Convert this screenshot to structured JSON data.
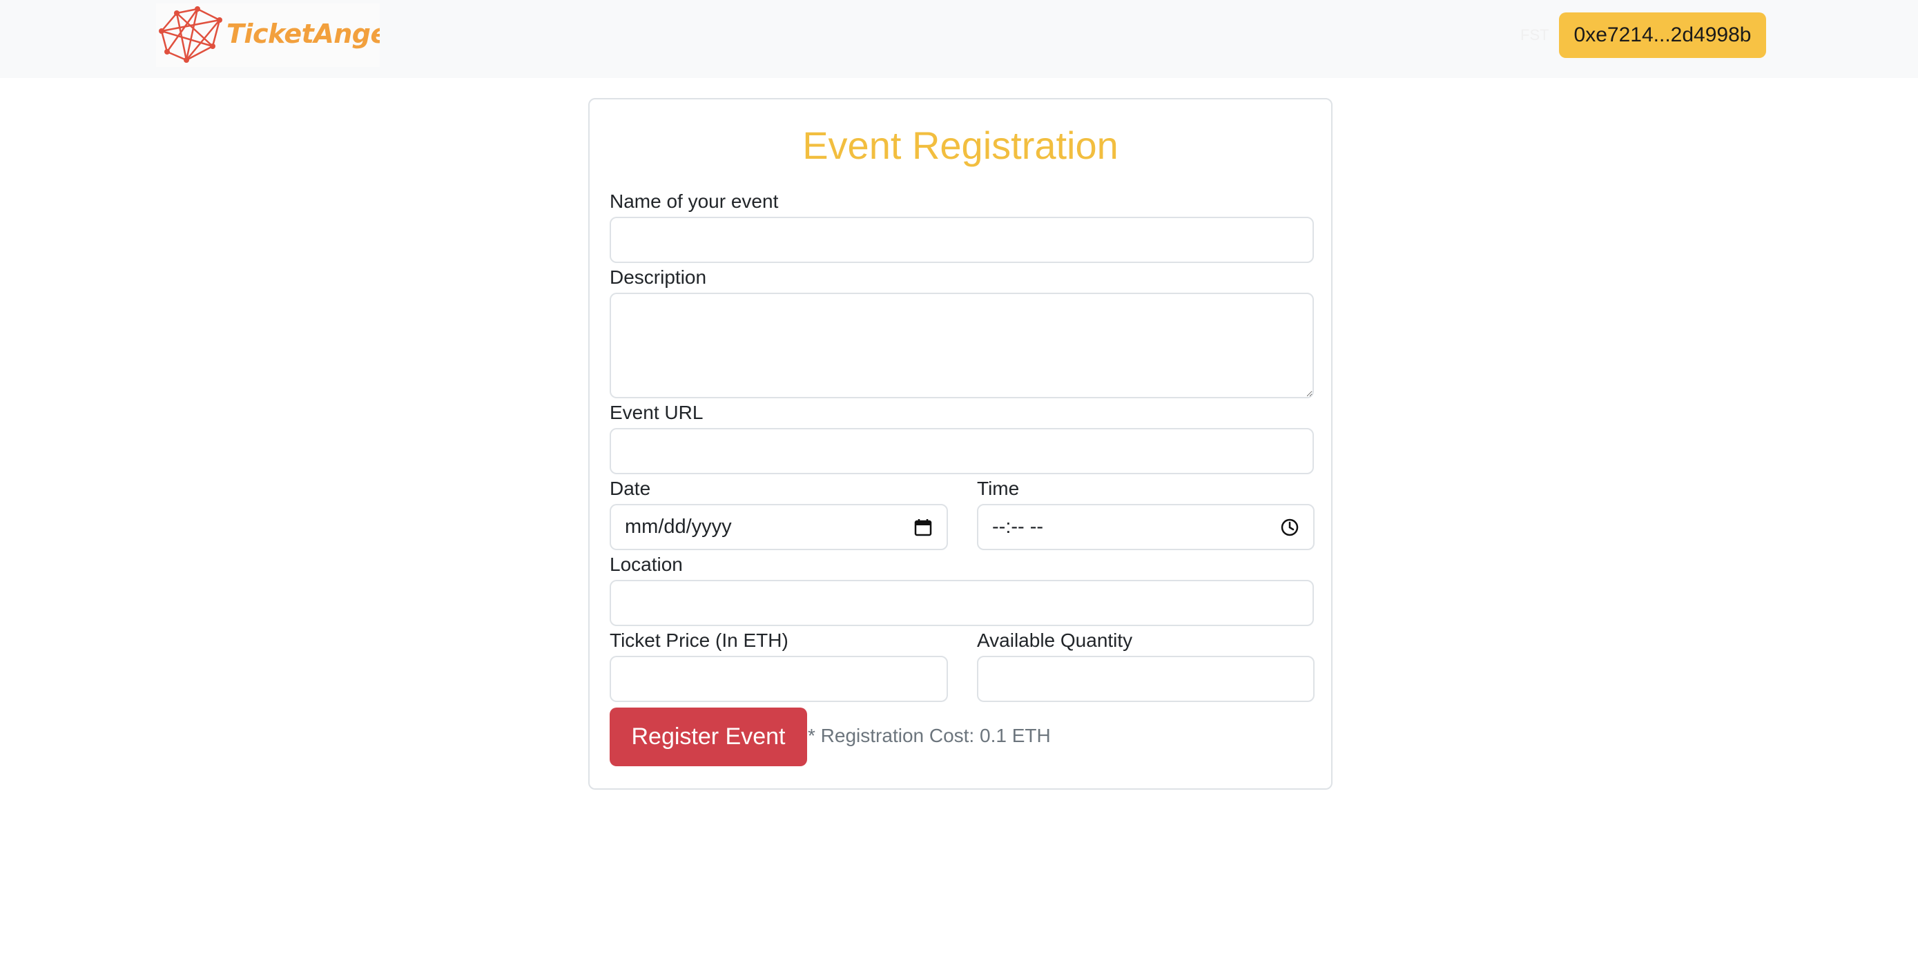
{
  "navbar": {
    "logo_text": "TicketAngel",
    "faint_text": "FST",
    "wallet_address": "0xe7214...2d4998b"
  },
  "form": {
    "title": "Event Registration",
    "fields": {
      "name": {
        "label": "Name of your event",
        "value": ""
      },
      "description": {
        "label": "Description",
        "value": ""
      },
      "url": {
        "label": "Event URL",
        "value": ""
      },
      "date": {
        "label": "Date",
        "value": "mm/dd/yyyy"
      },
      "time": {
        "label": "Time",
        "value": "--:-- --"
      },
      "location": {
        "label": "Location",
        "value": ""
      },
      "price": {
        "label": "Ticket Price (In ETH)",
        "value": ""
      },
      "quantity": {
        "label": "Available Quantity",
        "value": ""
      }
    },
    "submit_label": "Register Event",
    "cost_note": "* Registration Cost: 0.1 ETH"
  },
  "colors": {
    "accent": "#f2be3f",
    "wallet_button": "#f7c244",
    "submit_button": "#d0404a",
    "navbar_bg": "#f8f9fa"
  },
  "icons": {
    "date": "calendar-icon",
    "time": "clock-icon"
  }
}
